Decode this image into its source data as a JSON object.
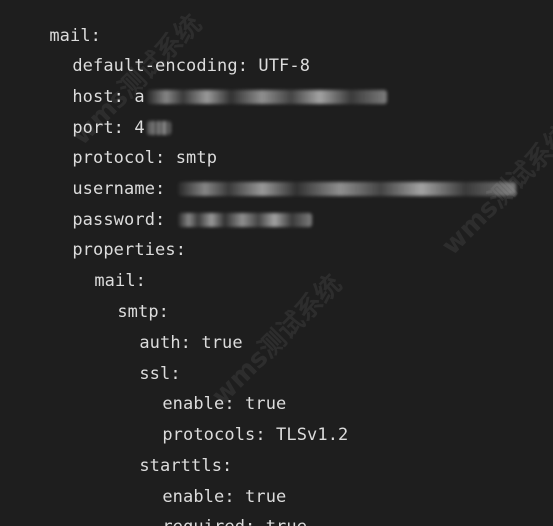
{
  "editor": {
    "lines": [
      {
        "key": "mail:",
        "value": ""
      },
      {
        "key": "default-encoding:",
        "value": "UTF-8"
      },
      {
        "key": "host:",
        "value": "a",
        "redacted": true
      },
      {
        "key": "port:",
        "value": "4",
        "redacted": true
      },
      {
        "key": "protocol:",
        "value": "smtp"
      },
      {
        "key": "username:",
        "value": "",
        "redacted": true
      },
      {
        "key": "password:",
        "value": "",
        "redacted": true
      },
      {
        "key": "properties:",
        "value": ""
      },
      {
        "key": "mail:",
        "value": ""
      },
      {
        "key": "smtp:",
        "value": ""
      },
      {
        "key": "auth:",
        "value": "true"
      },
      {
        "key": "ssl:",
        "value": ""
      },
      {
        "key": "enable:",
        "value": "true"
      },
      {
        "key": "protocols:",
        "value": "TLSv1.2"
      },
      {
        "key": "starttls:",
        "value": ""
      },
      {
        "key": "enable:",
        "value": "true"
      },
      {
        "key": "required:",
        "value": "true"
      }
    ]
  },
  "watermarks": [
    "wms测试系统",
    "wms测试系统",
    "wms测试系统"
  ]
}
